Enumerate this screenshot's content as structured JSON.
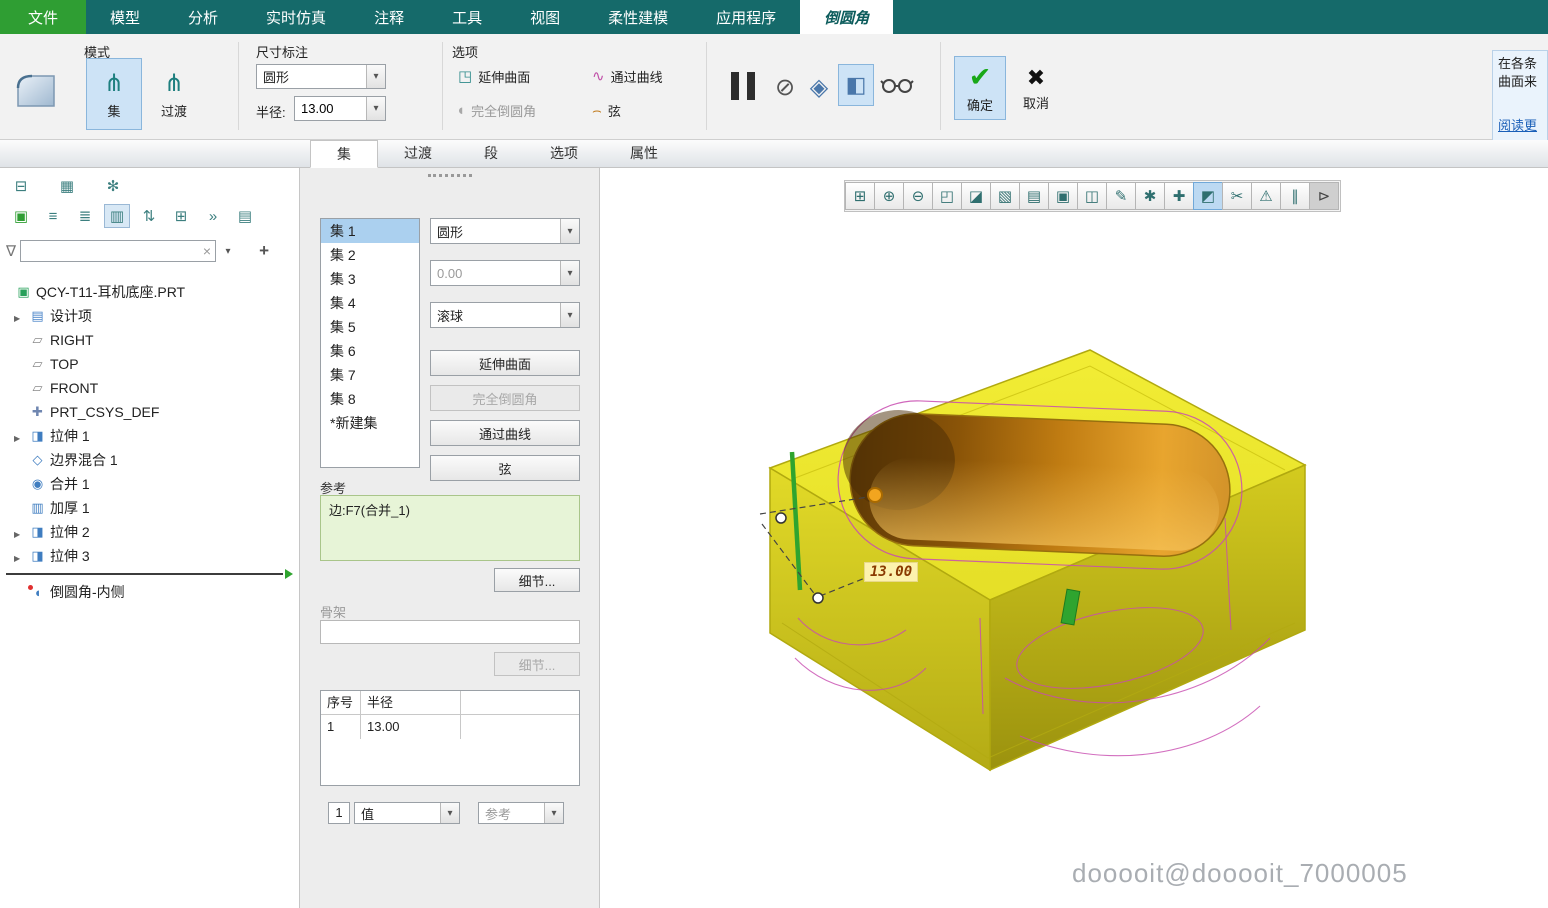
{
  "menubar": [
    {
      "label": "文件",
      "file": true
    },
    {
      "label": "模型"
    },
    {
      "label": "分析"
    },
    {
      "label": "实时仿真"
    },
    {
      "label": "注释"
    },
    {
      "label": "工具"
    },
    {
      "label": "视图"
    },
    {
      "label": "柔性建模"
    },
    {
      "label": "应用程序"
    },
    {
      "label": "倒圆角",
      "active": true
    }
  ],
  "ribbon": {
    "mode": {
      "title": "模式",
      "set_label": "集",
      "transition_label": "过渡"
    },
    "dimension": {
      "title": "尺寸标注",
      "shape_value": "圆形",
      "radius_label": "半径:",
      "radius_value": "13.00"
    },
    "options": {
      "title": "选项",
      "extend_surface": "延伸曲面",
      "through_curve": "通过曲线",
      "full_round": "完全倒圆角",
      "chord": "弦"
    },
    "ok_label": "确定",
    "cancel_label": "取消",
    "help_text_1": "在各条",
    "help_text_2": "曲面来",
    "help_link": "阅读更"
  },
  "tabstrip": [
    {
      "label": "集",
      "active": true
    },
    {
      "label": "过渡"
    },
    {
      "label": "段"
    },
    {
      "label": "选项"
    },
    {
      "label": "属性"
    }
  ],
  "tree": {
    "toolbar_row1": [
      {
        "name": "model-tree-icon",
        "glyph": "⊟"
      },
      {
        "name": "layer-tree-icon",
        "glyph": "▦"
      },
      {
        "name": "tree-settings-icon",
        "glyph": "✻"
      }
    ],
    "toolbar_row2": [
      {
        "name": "show-feature-icon",
        "glyph": "▣",
        "green": true
      },
      {
        "name": "list-view-icon",
        "glyph": "≡"
      },
      {
        "name": "detail-view-icon",
        "glyph": "≣"
      },
      {
        "name": "tree-filter-icon",
        "glyph": "▥",
        "pressed": true
      },
      {
        "name": "sort-tree-icon",
        "glyph": "⇅"
      },
      {
        "name": "column-display-icon",
        "glyph": "⊞"
      },
      {
        "name": "more-tools-icon",
        "glyph": "»"
      },
      {
        "name": "tree-options-icon",
        "glyph": "▤"
      }
    ],
    "part_label": "QCY-T11-耳机底座.PRT",
    "items": [
      {
        "label": "设计项",
        "icon": "icon-design",
        "icon_name": "design-items-icon",
        "arrow": true
      },
      {
        "label": "RIGHT",
        "icon": "icon-plane",
        "icon_name": "datum-plane-icon"
      },
      {
        "label": "TOP",
        "icon": "icon-plane",
        "icon_name": "datum-plane-icon"
      },
      {
        "label": "FRONT",
        "icon": "icon-plane",
        "icon_name": "datum-plane-icon"
      },
      {
        "label": "PRT_CSYS_DEF",
        "icon": "icon-csys",
        "icon_name": "csys-icon"
      },
      {
        "label": "拉伸 1",
        "icon": "icon-extrude",
        "icon_name": "extrude-icon",
        "arrow": true
      },
      {
        "label": "边界混合 1",
        "icon": "icon-blend",
        "icon_name": "boundary-blend-icon"
      },
      {
        "label": "合并 1",
        "icon": "icon-merge",
        "icon_name": "merge-icon"
      },
      {
        "label": "加厚 1",
        "icon": "icon-thicken",
        "icon_name": "thicken-icon"
      },
      {
        "label": "拉伸 2",
        "icon": "icon-extrude",
        "icon_name": "extrude-icon",
        "arrow": true
      },
      {
        "label": "拉伸 3",
        "icon": "icon-extrude",
        "icon_name": "extrude-icon",
        "arrow": true
      }
    ],
    "pending_label": "倒圆角-内侧"
  },
  "panel": {
    "sets": [
      {
        "label": "集 1",
        "selected": true
      },
      {
        "label": "集 2"
      },
      {
        "label": "集 3"
      },
      {
        "label": "集 4"
      },
      {
        "label": "集 5"
      },
      {
        "label": "集 6"
      },
      {
        "label": "集 7"
      },
      {
        "label": "集 8"
      },
      {
        "label": "*新建集"
      }
    ],
    "shape_value": "圆形",
    "radius_value": "0.00",
    "mode_value": "滚球",
    "extend_surface": "延伸曲面",
    "full_round": "完全倒圆角",
    "through_curve": "通过曲线",
    "chord": "弦",
    "references_label": "参考",
    "reference_value": "边:F7(合并_1)",
    "details_label": "细节...",
    "skeleton_label": "骨架",
    "skeleton_details_label": "细节...",
    "col_seq": "序号",
    "col_radius": "半径",
    "row_seq": "1",
    "row_radius": "13.00",
    "count_value": "1",
    "value_type": "值",
    "reference_type": "参考"
  },
  "viewport": {
    "toolbar": [
      {
        "name": "zoom-window-icon",
        "glyph": "⊞"
      },
      {
        "name": "zoom-in-icon",
        "glyph": "⊕"
      },
      {
        "name": "zoom-out-icon",
        "glyph": "⊖"
      },
      {
        "name": "refit-icon",
        "glyph": "◰"
      },
      {
        "name": "repaint-icon",
        "glyph": "◪"
      },
      {
        "name": "display-style-icon",
        "glyph": "▧"
      },
      {
        "name": "saved-orientations-icon",
        "glyph": "▤"
      },
      {
        "name": "capture-icon",
        "glyph": "▣"
      },
      {
        "name": "view-manager-icon",
        "glyph": "◫"
      },
      {
        "name": "annotation-display-icon",
        "glyph": "✎"
      },
      {
        "name": "datum-display-icon",
        "glyph": "✱"
      },
      {
        "name": "spin-center-icon",
        "glyph": "✚"
      },
      {
        "name": "3d-dragger-icon",
        "glyph": "◩",
        "sel": true
      },
      {
        "name": "section-icon",
        "glyph": "✂"
      },
      {
        "name": "warning-icon",
        "glyph": "⚠"
      },
      {
        "name": "pause-display-icon",
        "glyph": "∥"
      },
      {
        "name": "resume-icon",
        "glyph": "⊳",
        "dark": true
      }
    ],
    "dim_label": "13.00",
    "watermark": "dooooit@dooooit_7000005"
  }
}
